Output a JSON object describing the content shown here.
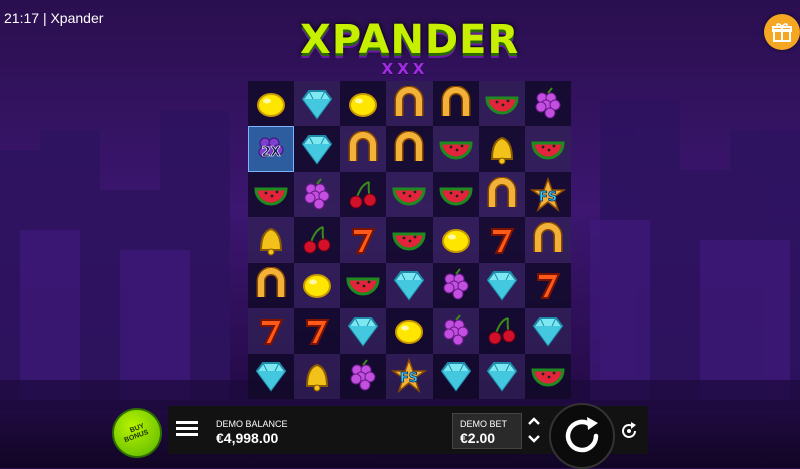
{
  "status_bar": {
    "time": "21:17",
    "separator": "|",
    "game_title": "Xpander"
  },
  "logo": {
    "title": "XPANDER",
    "sub": "XXX"
  },
  "reels": {
    "rows": [
      [
        "lemon",
        "diamond",
        "lemon",
        "horseshoe",
        "horseshoe",
        "watermelon",
        "grapes"
      ],
      [
        "grapes-2x",
        "diamond",
        "horseshoe",
        "horseshoe",
        "watermelon",
        "bell",
        "watermelon"
      ],
      [
        "watermelon",
        "grapes",
        "cherry",
        "watermelon",
        "watermelon",
        "horseshoe",
        "fs-scatter"
      ],
      [
        "bell",
        "cherry",
        "seven",
        "watermelon",
        "lemon",
        "seven",
        "horseshoe"
      ],
      [
        "horseshoe",
        "lemon",
        "watermelon",
        "diamond",
        "grapes",
        "diamond",
        "seven"
      ],
      [
        "seven",
        "seven",
        "diamond",
        "lemon",
        "grapes",
        "cherry",
        "diamond"
      ],
      [
        "diamond",
        "bell",
        "grapes",
        "fs-scatter",
        "diamond",
        "diamond",
        "watermelon"
      ]
    ],
    "multiplier_label": "2X",
    "scatter_label": "FS"
  },
  "buy_bonus": {
    "line1": "BUY",
    "line2": "BONUS"
  },
  "balance": {
    "label": "DEMO BALANCE",
    "value": "€4,998.00"
  },
  "bet": {
    "label": "DEMO BET",
    "value": "€2.00"
  },
  "icons": {
    "gift": "gift-icon",
    "menu": "menu-icon",
    "spin": "spin-icon",
    "autoplay": "autoplay-icon"
  },
  "colors": {
    "logo_green": "#c6f000",
    "logo_purple": "#a22de0",
    "gift": "#f5a623",
    "buy_green": "#8ad400",
    "panel": "#121212"
  }
}
